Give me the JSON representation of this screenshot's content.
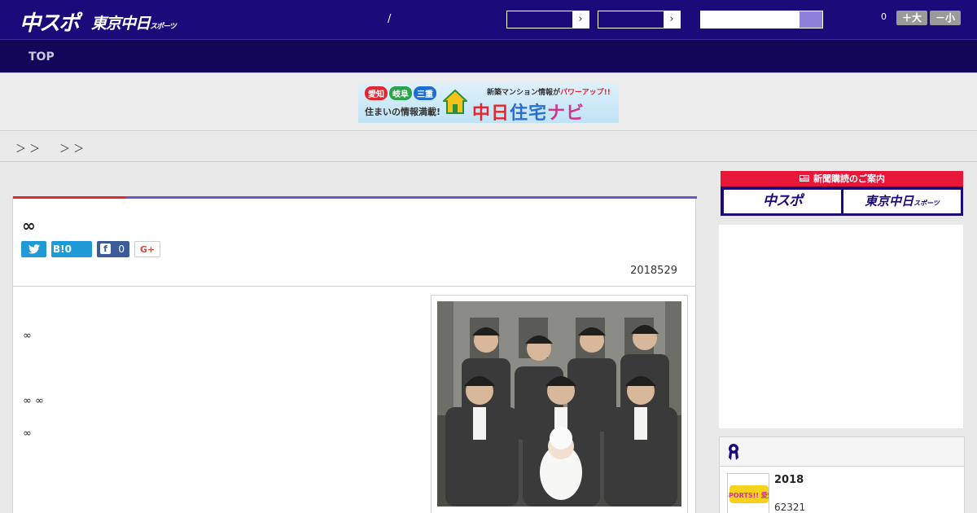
{
  "header": {
    "logo_chuspo": "中スポ",
    "logo_tokyo": "東京中日",
    "logo_tokyo_small": "スポーツ",
    "separator": "/",
    "dropdown1_arrow": "›",
    "dropdown2_arrow": "›",
    "count": "0",
    "font_big_label": "＋大",
    "font_small_label": "－小",
    "colors": {
      "bg": "#1a0a7a",
      "nav_bg": "#130557",
      "search_button": "#8e7fd8"
    }
  },
  "nav": {
    "items": [
      {
        "label": "TOP"
      }
    ]
  },
  "banner": {
    "pills": [
      "愛知",
      "岐阜",
      "三重"
    ],
    "tagline": "住まいの情報満載!",
    "promo_prefix": "新築マンション情報が",
    "promo_highlight": "パワーアップ!!",
    "brand_a": "中日",
    "brand_b": "住宅",
    "brand_c": "ナビ"
  },
  "breadcrumb": {
    "sep1": "＞ ＞",
    "sep2": "＞ ＞"
  },
  "article": {
    "title": "∞",
    "share": {
      "twitter_icon": "twitter-icon",
      "hatena_label": "B!0",
      "facebook_count": "0",
      "gplus_label": "G+"
    },
    "date": "2018529",
    "paragraphs": [
      "∞",
      "∞ ∞",
      "∞"
    ],
    "colors": {
      "accent_red": "#e3262f",
      "accent_purple": "#6b55c9"
    }
  },
  "sidebar": {
    "subscribe_heading": "新聞購読のご案内",
    "subscribe_chuspo": "中スポ",
    "subscribe_tokyo": "東京中日",
    "subscribe_tokyo_small": "スポーツ",
    "ranking": {
      "icon": "ribbon-icon",
      "item_title": "2018",
      "item_meta": "62321",
      "thumb_label": "SPORTS!! 愛知"
    }
  }
}
